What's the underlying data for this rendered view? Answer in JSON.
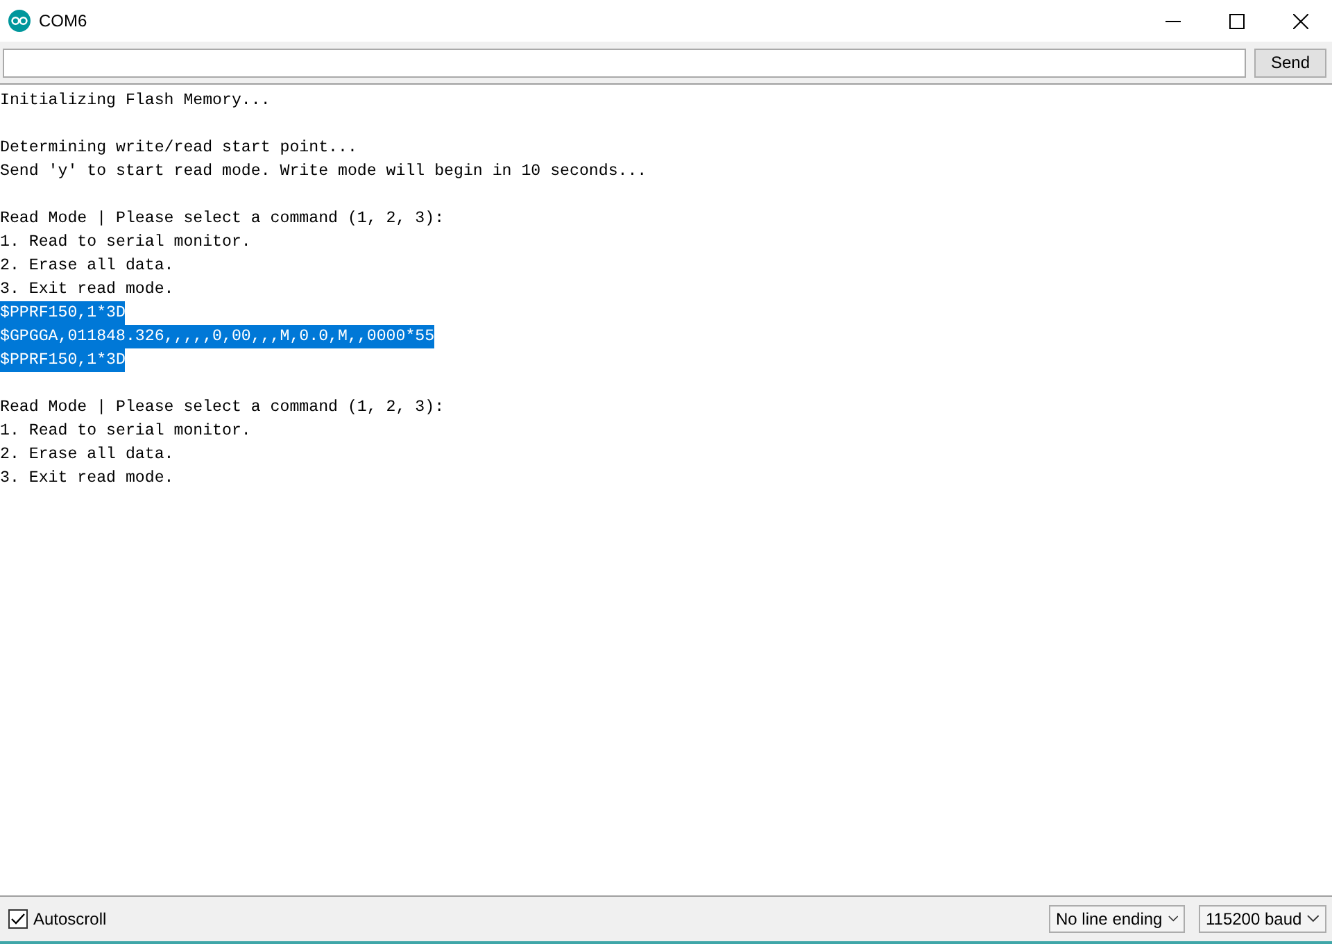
{
  "window": {
    "title": "COM6"
  },
  "send_bar": {
    "button": "Send"
  },
  "output": {
    "blocks": [
      [
        {
          "text": "Initializing Flash Memory...",
          "selected": false
        }
      ],
      [
        {
          "text": "Determining write/read start point...",
          "selected": false
        },
        {
          "text": "Send 'y' to start read mode. Write mode will begin in 10 seconds...",
          "selected": false
        }
      ],
      [
        {
          "text": "Read Mode | Please select a command (1, 2, 3):",
          "selected": false
        },
        {
          "text": "1. Read to serial monitor.",
          "selected": false
        },
        {
          "text": "2. Erase all data.",
          "selected": false
        },
        {
          "text": "3. Exit read mode.",
          "selected": false
        },
        {
          "text": "$PPRF150,1*3D",
          "selected": true
        },
        {
          "text": "$GPGGA,011848.326,,,,,0,00,,,M,0.0,M,,0000*55",
          "selected": true
        },
        {
          "text": "$PPRF150,1*3D",
          "selected": true
        }
      ],
      [
        {
          "text": "Read Mode | Please select a command (1, 2, 3):",
          "selected": false
        },
        {
          "text": "1. Read to serial monitor.",
          "selected": false
        },
        {
          "text": "2. Erase all data.",
          "selected": false
        },
        {
          "text": "3. Exit read mode.",
          "selected": false
        }
      ]
    ]
  },
  "status_bar": {
    "autoscroll": {
      "label": "Autoscroll",
      "checked": true
    },
    "line_ending": "No line ending",
    "baud": "115200 baud"
  }
}
